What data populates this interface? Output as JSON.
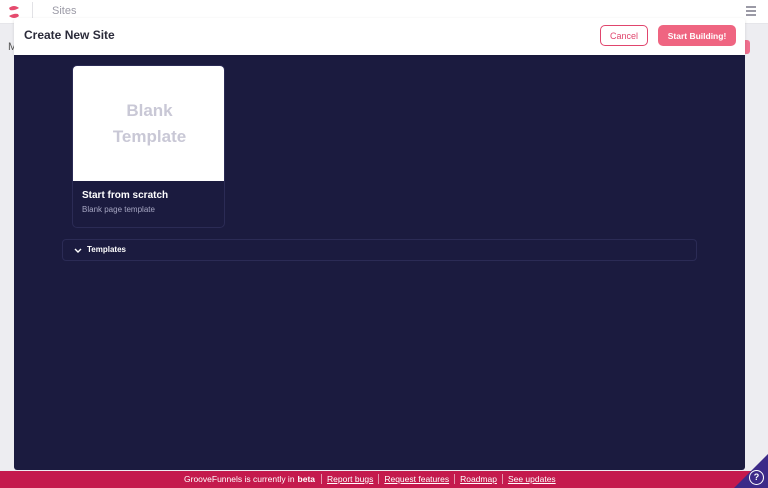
{
  "app": {
    "title": "Sites",
    "bg_letter": "M"
  },
  "modal": {
    "title": "Create New Site",
    "cancel_label": "Cancel",
    "start_label": "Start Building!"
  },
  "template_card": {
    "preview_text": "Blank Template",
    "title": "Start from scratch",
    "subtitle": "Blank page template"
  },
  "templates_section": {
    "label": "Templates"
  },
  "beta_bar": {
    "prefix": "GrooveFunnels is currently in",
    "status": "beta",
    "links": [
      "Report bugs",
      "Request features",
      "Roadmap",
      "See updates"
    ]
  },
  "help": {
    "glyph": "?"
  },
  "colors": {
    "accent": "#e0456d",
    "modal_body": "#1b1b3f",
    "beta_bar": "#c41a4d"
  },
  "icons": {
    "logo": "groove-logo-icon",
    "menu": "hamburger-icon",
    "chevron": "chevron-down-icon",
    "help": "help-icon"
  }
}
